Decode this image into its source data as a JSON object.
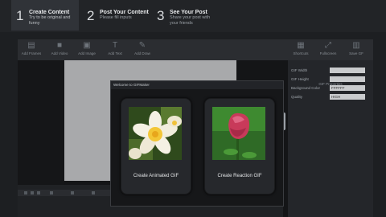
{
  "steps": [
    {
      "num": "1",
      "title": "Create Content",
      "sub1": "Try to be original and",
      "sub2": "funny"
    },
    {
      "num": "2",
      "title": "Post Your Content",
      "sub1": "Please fill inputs",
      "sub2": ""
    },
    {
      "num": "3",
      "title": "See Your Post",
      "sub1": "Share your post with",
      "sub2": "your friends"
    }
  ],
  "toolbar": {
    "left": [
      {
        "icon": "film-icon",
        "label": "Add Frames"
      },
      {
        "icon": "video-icon",
        "label": "Add Video"
      },
      {
        "icon": "image-icon",
        "label": "Add Image"
      },
      {
        "icon": "text-icon",
        "label": "Add Text"
      },
      {
        "icon": "brush-icon",
        "label": "Add Draw"
      }
    ],
    "right": [
      {
        "icon": "grid-icon",
        "label": "Shortcuts"
      },
      {
        "icon": "fullscreen-icon",
        "label": "Fullscreen"
      },
      {
        "icon": "save-icon",
        "label": "Save GF"
      }
    ]
  },
  "properties": {
    "header": "GIF Properties",
    "rows": [
      {
        "label": "GIF Width",
        "value": ""
      },
      {
        "label": "GIF Height",
        "value": ""
      },
      {
        "label": "Background Color",
        "value": "FFFFFF"
      },
      {
        "label": "Quality",
        "value": "HIGH"
      }
    ]
  },
  "dialog": {
    "title": "Welcome to GIFMaker",
    "cards": [
      {
        "label": "Create Animated GIF",
        "image": "plumeria-flower"
      },
      {
        "label": "Create Reaction GIF",
        "image": "pink-rose"
      }
    ]
  },
  "colors": {
    "background": "#1d1f22",
    "active_step": "#303338",
    "stage": "#a8a9ab"
  }
}
